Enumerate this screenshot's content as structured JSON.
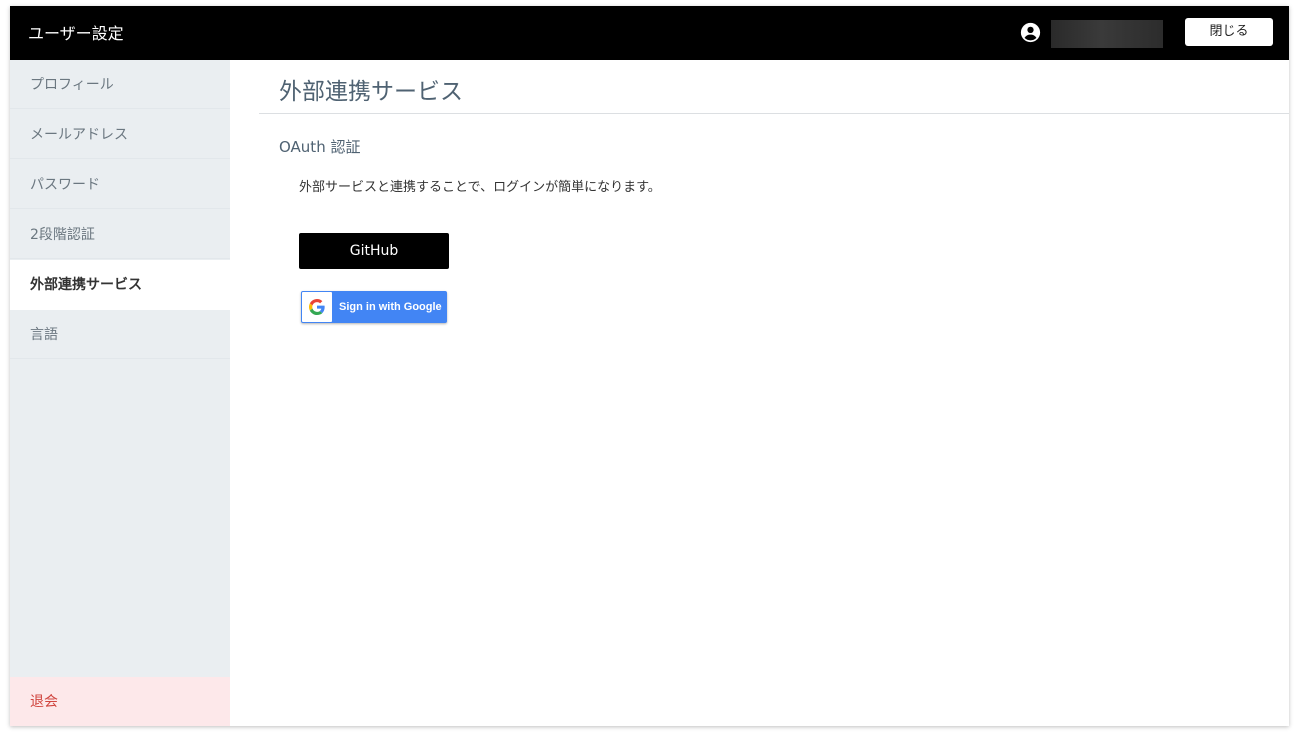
{
  "header": {
    "title": "ユーザー設定",
    "user_icon": "account-circle-icon",
    "close_label": "閉じる"
  },
  "sidebar": {
    "items": [
      {
        "label": "プロフィール",
        "active": false
      },
      {
        "label": "メールアドレス",
        "active": false
      },
      {
        "label": "パスワード",
        "active": false
      },
      {
        "label": "2段階認証",
        "active": false
      },
      {
        "label": "外部連携サービス",
        "active": true
      },
      {
        "label": "言語",
        "active": false
      }
    ],
    "withdraw_label": "退会"
  },
  "main": {
    "page_title": "外部連携サービス",
    "section_title": "OAuth 認証",
    "description": "外部サービスと連携することで、ログインが簡単になります。",
    "github_label": "GitHub",
    "google_label": "Sign in with Google",
    "google_icon": "google-g-logo-icon"
  },
  "colors": {
    "header_bg": "#000000",
    "sidebar_bg": "#eaeef1",
    "active_item_bg": "#ffffff",
    "danger_bg": "#fde8ea",
    "danger_text": "#d0453f",
    "title_text": "#4f6272",
    "google_blue": "#4285f4"
  }
}
